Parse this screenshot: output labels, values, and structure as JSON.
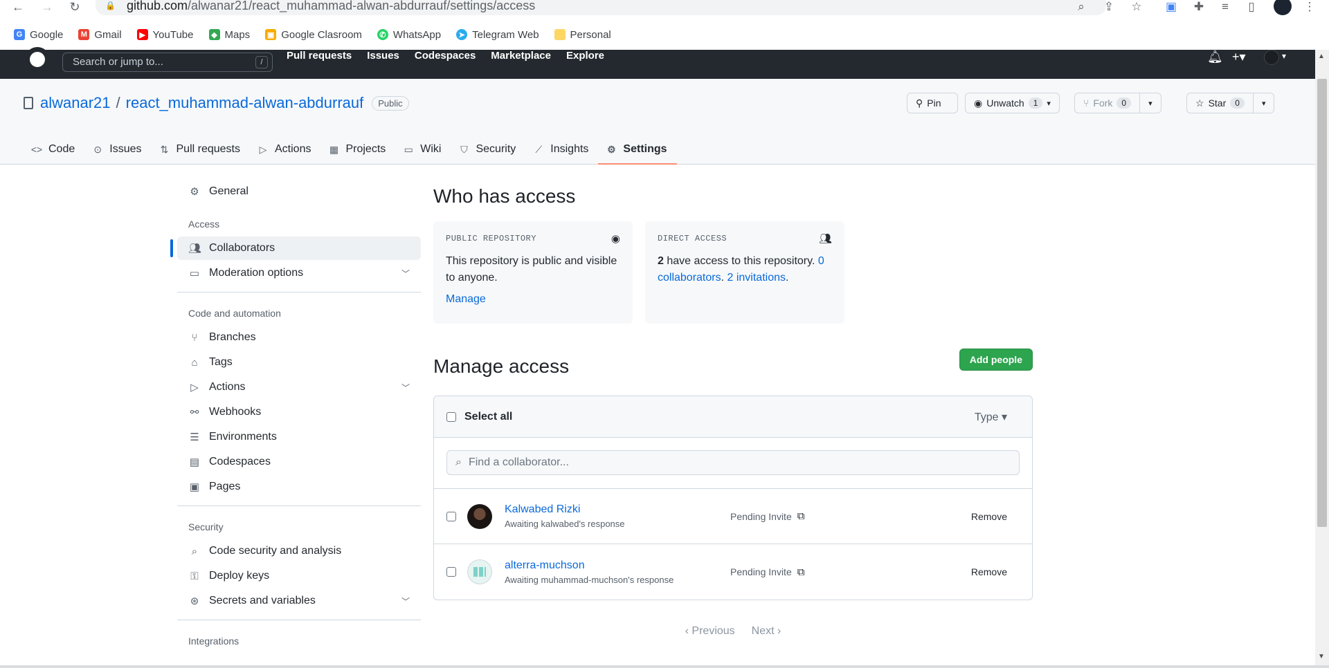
{
  "browser": {
    "url_host": "github.com",
    "url_path": "/alwanar21/react_muhammad-alwan-abdurrauf/settings/access",
    "bookmarks": [
      {
        "label": "Google",
        "color": "#4285f4",
        "glyph": "G"
      },
      {
        "label": "Gmail",
        "color": "#ea4335",
        "glyph": "M"
      },
      {
        "label": "YouTube",
        "color": "#ff0000",
        "glyph": "▶"
      },
      {
        "label": "Maps",
        "color": "#34a853",
        "glyph": "◆"
      },
      {
        "label": "Google Clasroom",
        "color": "#f9ab00",
        "glyph": "▣"
      },
      {
        "label": "WhatsApp",
        "color": "#25d366",
        "glyph": "✆"
      },
      {
        "label": "Telegram Web",
        "color": "#2aabee",
        "glyph": "➤"
      },
      {
        "label": "Personal",
        "color": "#fdd663",
        "glyph": ""
      }
    ]
  },
  "gh_header": {
    "search_placeholder": "Search or jump to...",
    "search_key": "/",
    "nav": [
      "Pull requests",
      "Issues",
      "Codespaces",
      "Marketplace",
      "Explore"
    ]
  },
  "repo": {
    "owner": "alwanar21",
    "separator": "/",
    "name": "react_muhammad-alwan-abdurrauf",
    "visibility": "Public",
    "pin_label": "Pin",
    "watch_label": "Unwatch",
    "watch_count": "1",
    "fork_label": "Fork",
    "fork_count": "0",
    "star_label": "Star",
    "star_count": "0",
    "tabs": [
      {
        "label": "Code",
        "icon": "<>"
      },
      {
        "label": "Issues",
        "icon": "⊙"
      },
      {
        "label": "Pull requests",
        "icon": "⇅"
      },
      {
        "label": "Actions",
        "icon": "▷"
      },
      {
        "label": "Projects",
        "icon": "▦"
      },
      {
        "label": "Wiki",
        "icon": "▭"
      },
      {
        "label": "Security",
        "icon": "⛉"
      },
      {
        "label": "Insights",
        "icon": "⟋"
      },
      {
        "label": "Settings",
        "icon": "⚙"
      }
    ]
  },
  "sidebar": {
    "general": "General",
    "access_heading": "Access",
    "collaborators": "Collaborators",
    "moderation": "Moderation options",
    "code_heading": "Code and automation",
    "branches": "Branches",
    "tags": "Tags",
    "actions": "Actions",
    "webhooks": "Webhooks",
    "environments": "Environments",
    "codespaces": "Codespaces",
    "pages": "Pages",
    "security_heading": "Security",
    "code_security": "Code security and analysis",
    "deploy_keys": "Deploy keys",
    "secrets": "Secrets and variables",
    "integrations_heading": "Integrations"
  },
  "main": {
    "title": "Who has access",
    "public_card": {
      "label": "PUBLIC REPOSITORY",
      "text": "This repository is public and visible to anyone.",
      "link": "Manage"
    },
    "direct_card": {
      "label": "DIRECT ACCESS",
      "count": "2",
      "text": " have access to this repository. ",
      "collab_link": "0 collaborators",
      "dot": ". ",
      "invite_link": "2 invitations",
      "end": "."
    },
    "manage_title": "Manage access",
    "add_button": "Add people",
    "select_all": "Select all",
    "type_filter": "Type ▾",
    "search_placeholder": "Find a collaborator...",
    "rows": [
      {
        "name": "Kalwabed Rizki",
        "sub": "Awaiting kalwabed's response",
        "status": "Pending Invite",
        "action": "Remove"
      },
      {
        "name": "alterra-muchson",
        "sub": "Awaiting muhammad-muchson's response",
        "status": "Pending Invite",
        "action": "Remove"
      }
    ],
    "prev": "Previous",
    "next": "Next"
  }
}
